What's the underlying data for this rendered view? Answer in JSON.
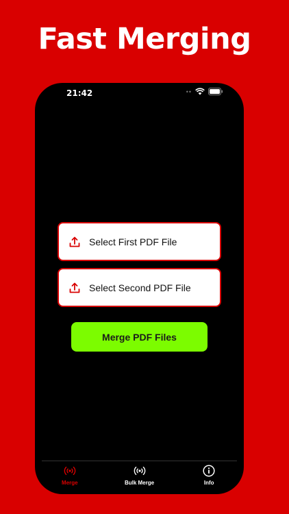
{
  "headline": "Fast Merging",
  "status_bar": {
    "time": "21:42"
  },
  "main": {
    "select_first_label": "Select First PDF File",
    "select_second_label": "Select Second PDF File",
    "merge_label": "Merge PDF Files"
  },
  "tabs": [
    {
      "label": "Merge",
      "icon": "broadcast-icon",
      "active": true
    },
    {
      "label": "Bulk Merge",
      "icon": "broadcast-icon",
      "active": false
    },
    {
      "label": "Info",
      "icon": "info-icon",
      "active": false
    }
  ],
  "colors": {
    "background": "#d90000",
    "accent_red": "#d90000",
    "merge_button": "#7cfc00",
    "phone_screen": "#000000"
  }
}
